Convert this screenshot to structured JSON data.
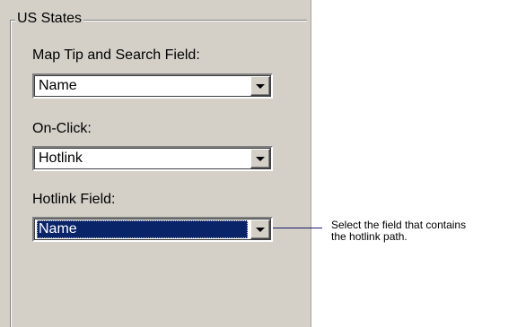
{
  "group": {
    "title": "US States"
  },
  "fields": [
    {
      "label": "Map Tip and Search Field:",
      "value": "Name",
      "selected": false
    },
    {
      "label": "On-Click:",
      "value": "Hotlink",
      "selected": false
    },
    {
      "label": "Hotlink Field:",
      "value": "Name",
      "selected": true
    }
  ],
  "callout": {
    "line1": "Select the field that contains",
    "line2": "the hotlink path."
  },
  "icons": {
    "dropdown": "chevron-down-icon"
  },
  "colors": {
    "panel_bg": "#d4d0c8",
    "selection_bg": "#0a246a",
    "selection_text": "#ffffff",
    "callout_line": "#1a1a66"
  }
}
